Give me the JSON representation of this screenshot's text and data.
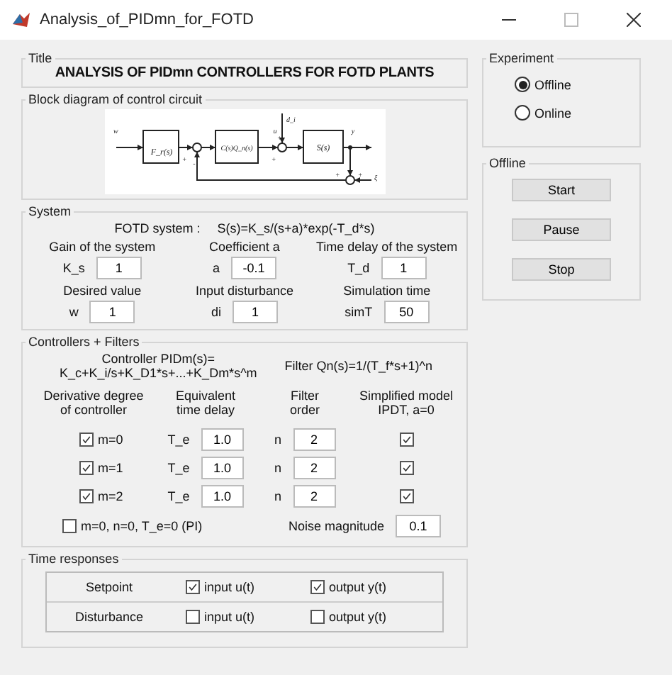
{
  "window": {
    "title": "Analysis_of_PIDmn_for_FOTD"
  },
  "title_panel": {
    "legend": "Title",
    "text": "ANALYSIS OF PIDmn CONTROLLERS FOR FOTD PLANTS"
  },
  "diagram_panel": {
    "legend": "Block diagram of control circuit",
    "labels": [
      "w",
      "F_r(s)",
      "C(s)Q_n(s)",
      "u",
      "d_i",
      "S(s)",
      "y",
      "ξ",
      "+",
      "-",
      "+",
      "+",
      "+",
      "+"
    ]
  },
  "system": {
    "legend": "System",
    "formula_label": "FOTD system :",
    "formula": "S(s)=K_s/(s+a)*exp(-T_d*s)",
    "params": [
      {
        "heading": "Gain of the system",
        "symbol": "K_s",
        "value": "1"
      },
      {
        "heading": "Coefficient a",
        "symbol": "a",
        "value": "-0.1"
      },
      {
        "heading": "Time delay of the system",
        "symbol": "T_d",
        "value": "1"
      },
      {
        "heading": "Desired value",
        "symbol": "w",
        "value": "1"
      },
      {
        "heading": "Input disturbance",
        "symbol": "di",
        "value": "1"
      },
      {
        "heading": "Simulation time",
        "symbol": "simT",
        "value": "50"
      }
    ]
  },
  "controllers": {
    "legend": "Controllers + Filters",
    "controller_formula": [
      "Controller PIDm(s)=",
      "K_c+K_i/s+K_D1*s+...+K_Dm*s^m"
    ],
    "filter_formula": "Filter Qn(s)=1/(T_f*s+1)^n",
    "headings": [
      [
        "Derivative degree",
        "of controller"
      ],
      [
        "Equivalent",
        "time delay"
      ],
      [
        "Filter",
        "order"
      ],
      [
        "Simplified model",
        "IPDT, a=0"
      ]
    ],
    "rows": [
      {
        "label": "m=0",
        "checked": true,
        "te_label": "T_e",
        "te": "1.0",
        "n_label": "n",
        "n": "2",
        "ipdt_checked": true
      },
      {
        "label": "m=1",
        "checked": true,
        "te_label": "T_e",
        "te": "1.0",
        "n_label": "n",
        "n": "2",
        "ipdt_checked": true
      },
      {
        "label": "m=2",
        "checked": true,
        "te_label": "T_e",
        "te": "1.0",
        "n_label": "n",
        "n": "2",
        "ipdt_checked": true
      }
    ],
    "pi_option": {
      "label": "m=0, n=0, T_e=0 (PI)",
      "checked": false
    },
    "noise": {
      "label": "Noise magnitude",
      "value": "0.1"
    }
  },
  "time_responses": {
    "legend": "Time responses",
    "rows": [
      {
        "label": "Setpoint",
        "input": {
          "label": "input u(t)",
          "checked": true
        },
        "output": {
          "label": "output y(t)",
          "checked": true
        }
      },
      {
        "label": "Disturbance",
        "input": {
          "label": "input u(t)",
          "checked": false
        },
        "output": {
          "label": "output y(t)",
          "checked": false
        }
      }
    ]
  },
  "experiment": {
    "legend": "Experiment",
    "options": [
      {
        "label": "Offline",
        "selected": true
      },
      {
        "label": "Online",
        "selected": false
      }
    ]
  },
  "offline": {
    "legend": "Offline",
    "buttons": [
      "Start",
      "Pause",
      "Stop"
    ]
  }
}
